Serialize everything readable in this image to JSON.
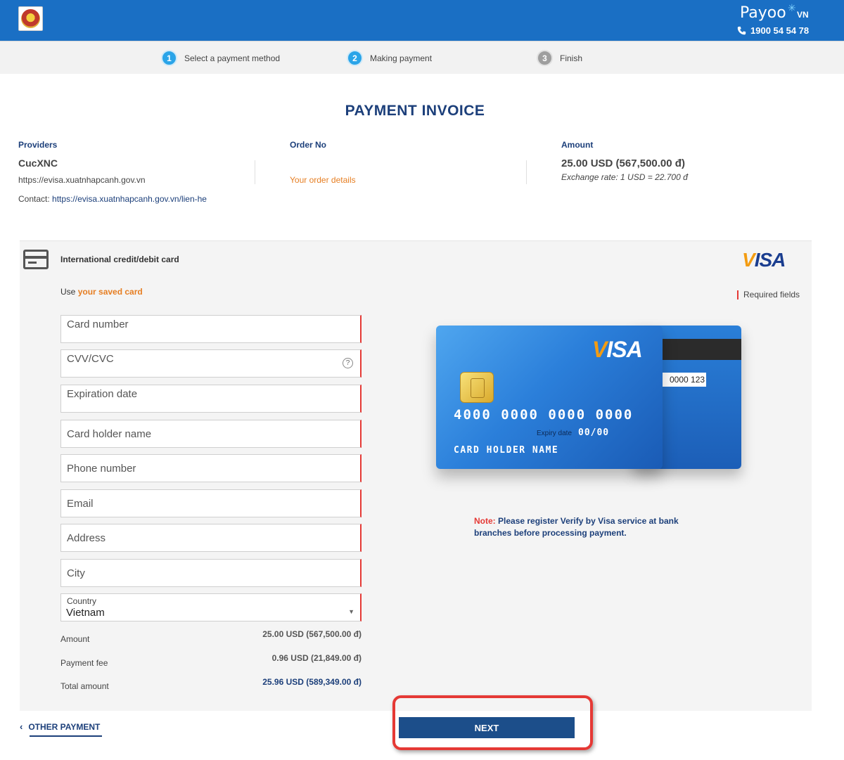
{
  "header": {
    "brand": "Payoo",
    "language": "VN",
    "hotline": "1900 54 54 78"
  },
  "steps": [
    {
      "num": "1",
      "label": "Select a payment method"
    },
    {
      "num": "2",
      "label": "Making payment"
    },
    {
      "num": "3",
      "label": "Finish"
    }
  ],
  "invoice": {
    "title": "PAYMENT INVOICE",
    "providers_label": "Providers",
    "provider_name": "CucXNC",
    "provider_url": "https://evisa.xuatnhapcanh.gov.vn",
    "contact_label": "Contact:",
    "contact_url": "https://evisa.xuatnhapcanh.gov.vn/lien-he",
    "order_label": "Order No",
    "order_link": "Your order details",
    "amount_label": "Amount",
    "amount_value": "25.00 USD (567,500.00 đ)",
    "exchange_rate": "Exchange rate: 1 USD = 22.700 đ"
  },
  "payment": {
    "method_title": "International credit/debit card",
    "brand": "VISA",
    "use_text": "Use",
    "saved_card_link": "your saved card",
    "required_fields": "Required fields",
    "fields": {
      "card_number": "Card number",
      "cvv": "CVV/CVC",
      "expiration": "Expiration date",
      "holder": "Card holder name",
      "phone": "Phone number",
      "email": "Email",
      "address": "Address",
      "city": "City",
      "country_label": "Country",
      "country_value": "Vietnam"
    },
    "summary": {
      "amount_label": "Amount",
      "amount_value": "25.00 USD (567,500.00 đ)",
      "fee_label": "Payment fee",
      "fee_value": "0.96 USD (21,849.00 đ)",
      "total_label": "Total amount",
      "total_value": "25.96 USD (589,349.00 đ)"
    }
  },
  "card_graphic": {
    "brand": "VISA",
    "number": "4000 0000 0000 0000",
    "expiry_label": "Expiry date",
    "expiry_value": "00/00",
    "holder": "CARD HOLDER NAME",
    "cvv_sample": "0000 123"
  },
  "note": {
    "prefix": "Note:",
    "text": "Please register Verify by Visa service at bank branches before processing payment."
  },
  "footer": {
    "other_payment": "OTHER PAYMENT",
    "next": "NEXT"
  },
  "colors": {
    "header_blue": "#1a6fc4",
    "navy": "#1c3f7a",
    "accent_orange": "#e67e22",
    "required_red": "#e53935",
    "step_blue": "#2aa4e8"
  }
}
